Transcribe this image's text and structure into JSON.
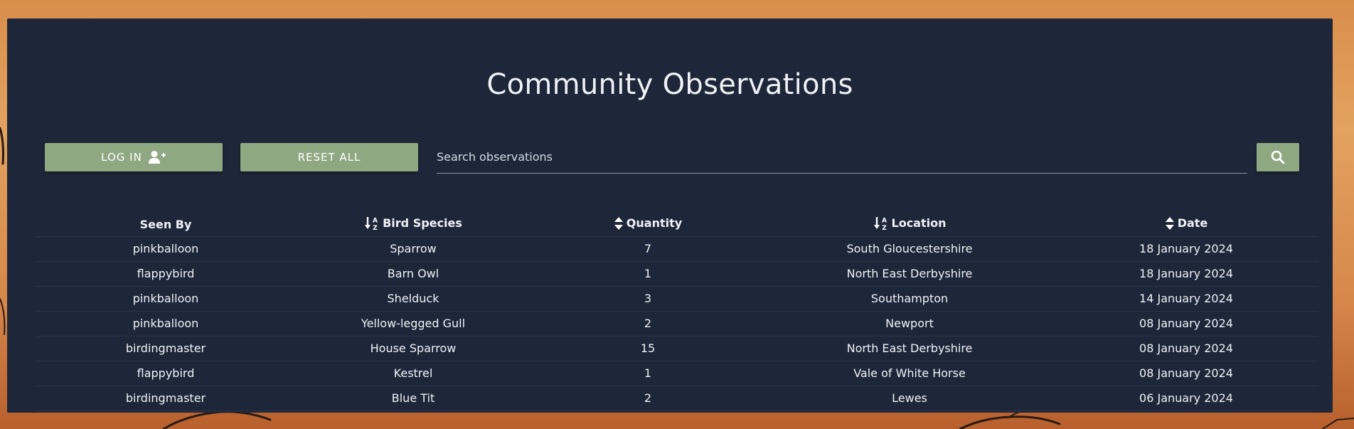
{
  "page": {
    "title": "Community Observations"
  },
  "toolbar": {
    "login_label": "LOG IN",
    "reset_label": "RESET ALL",
    "search_placeholder": "Search observations"
  },
  "icons": {
    "login": "user-plus-icon",
    "search": "search-icon",
    "sort_alpha": "sort-alpha-down-icon",
    "sort": "sort-icon"
  },
  "colors": {
    "panel": "#1d2739",
    "button": "#8fa882",
    "text": "#f1f3f6"
  },
  "table": {
    "columns": [
      {
        "label": "Seen By",
        "sort_icon": "none"
      },
      {
        "label": "Bird Species",
        "sort_icon": "sort-alpha-down-icon"
      },
      {
        "label": "Quantity",
        "sort_icon": "sort-icon"
      },
      {
        "label": "Location",
        "sort_icon": "sort-alpha-down-icon"
      },
      {
        "label": "Date",
        "sort_icon": "sort-icon"
      }
    ],
    "rows": [
      [
        "pinkballoon",
        "Sparrow",
        "7",
        "South Gloucestershire",
        "18 January 2024"
      ],
      [
        "flappybird",
        "Barn Owl",
        "1",
        "North East Derbyshire",
        "18 January 2024"
      ],
      [
        "pinkballoon",
        "Shelduck",
        "3",
        "Southampton",
        "14 January 2024"
      ],
      [
        "pinkballoon",
        "Yellow-legged Gull",
        "2",
        "Newport",
        "08 January 2024"
      ],
      [
        "birdingmaster",
        "House Sparrow",
        "15",
        "North East Derbyshire",
        "08 January 2024"
      ],
      [
        "flappybird",
        "Kestrel",
        "1",
        "Vale of White Horse",
        "08 January 2024"
      ],
      [
        "birdingmaster",
        "Blue Tit",
        "2",
        "Lewes",
        "06 January 2024"
      ]
    ]
  }
}
